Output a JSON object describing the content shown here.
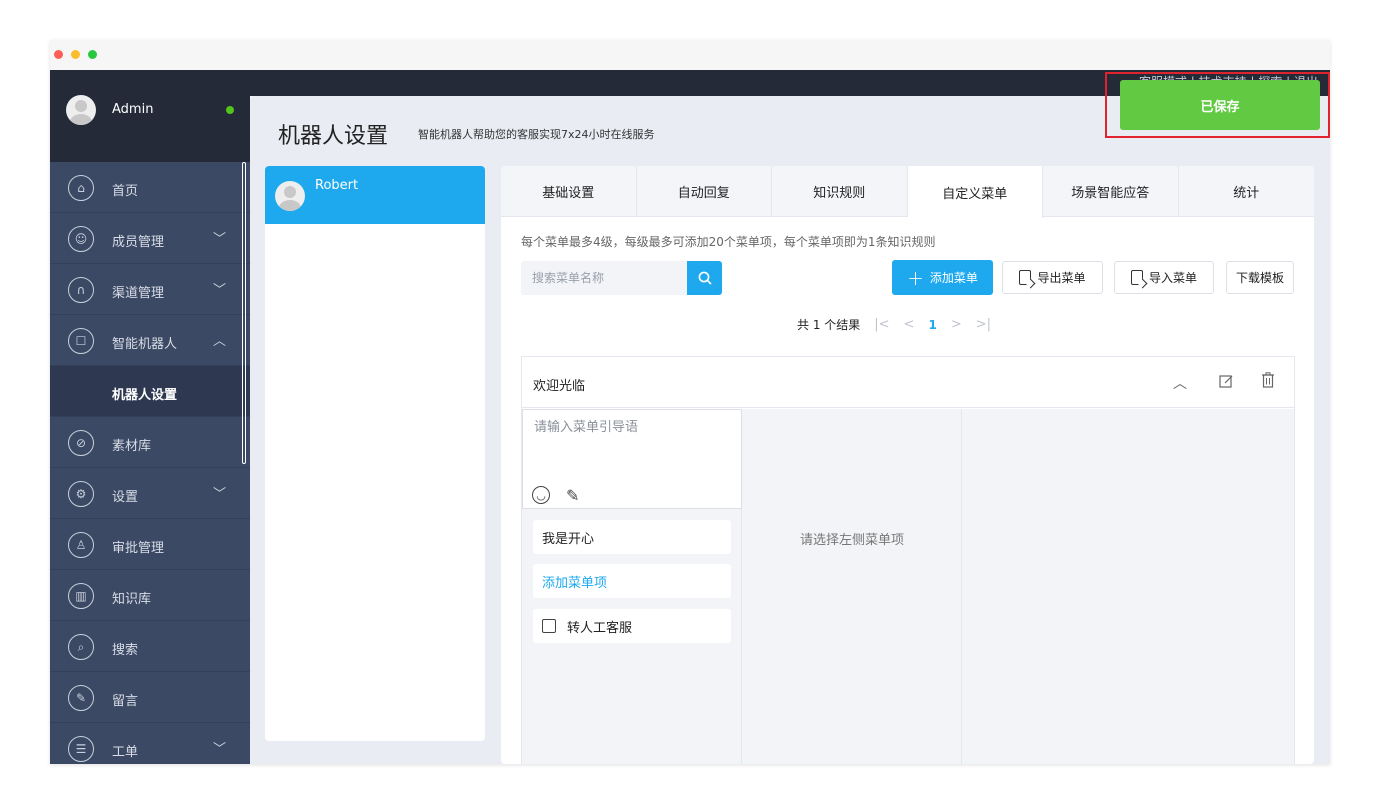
{
  "user": {
    "name": "Admin",
    "status_color": "#52c41a"
  },
  "sidebar": {
    "items": [
      {
        "label": "首页",
        "icon": "home-icon",
        "glyph": "⌂",
        "chevron": ""
      },
      {
        "label": "成员管理",
        "icon": "members-icon",
        "glyph": "☺",
        "chevron": "﹀"
      },
      {
        "label": "渠道管理",
        "icon": "channel-icon",
        "glyph": "∩",
        "chevron": "﹀"
      },
      {
        "label": "智能机器人",
        "icon": "robot-icon",
        "glyph": "☐",
        "chevron": "︿"
      },
      {
        "label": "机器人设置",
        "icon": "",
        "glyph": "",
        "chevron": ""
      },
      {
        "label": "素材库",
        "icon": "paperclip-icon",
        "glyph": "⊘",
        "chevron": ""
      },
      {
        "label": "设置",
        "icon": "gear-icon",
        "glyph": "⚙",
        "chevron": "﹀"
      },
      {
        "label": "审批管理",
        "icon": "stamp-icon",
        "glyph": "♙",
        "chevron": ""
      },
      {
        "label": "知识库",
        "icon": "book-icon",
        "glyph": "▥",
        "chevron": ""
      },
      {
        "label": "搜索",
        "icon": "search-icon",
        "glyph": "⌕",
        "chevron": ""
      },
      {
        "label": "留言",
        "icon": "message-edit-icon",
        "glyph": "✎",
        "chevron": ""
      },
      {
        "label": "工单",
        "icon": "ticket-icon",
        "glyph": "☰",
        "chevron": "﹀"
      }
    ]
  },
  "topbar": {
    "links": "客服模式 | 技术支持 | 探索 | 退出"
  },
  "page": {
    "title": "机器人设置",
    "subtitle": "智能机器人帮助您的客服实现7x24小时在线服务"
  },
  "bots": [
    {
      "name": "Robert"
    }
  ],
  "tabs": [
    "基础设置",
    "自动回复",
    "知识规则",
    "自定义菜单",
    "场景智能应答",
    "统计"
  ],
  "active_tab": 3,
  "hint": "每个菜单最多4级，每级最多可添加20个菜单项，每个菜单项即为1条知识规则",
  "search": {
    "placeholder": "搜索菜单名称"
  },
  "toolbar": {
    "add_label": "添加菜单",
    "export_label": "导出菜单",
    "import_label": "导入菜单",
    "template_label": "下载模板"
  },
  "pager": {
    "summary": "共 1 个结果",
    "first": "|<",
    "prev": "<",
    "page": "1",
    "next": ">",
    "last": ">|"
  },
  "menu": {
    "title": "欢迎光临",
    "guide_placeholder": "请输入菜单引导语",
    "items": [
      "我是开心"
    ],
    "add_item_label": "添加菜单项",
    "transfer_label": "转人工客服",
    "col2_hint": "请选择左侧菜单项"
  },
  "toast": {
    "text": "已保存",
    "color": "#62c943"
  },
  "colors": {
    "accent": "#1ea9ef",
    "sidebar": "#3c4964",
    "highlight_frame": "#e0232e"
  }
}
